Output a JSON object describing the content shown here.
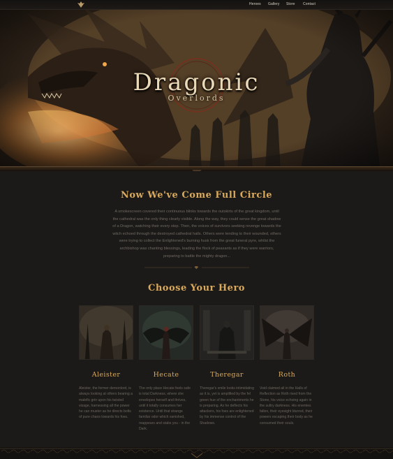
{
  "nav": {
    "items": [
      "Heroes",
      "Gallery",
      "Store",
      "Contact"
    ]
  },
  "hero": {
    "title": "Dragonic",
    "subtitle": "Overlords"
  },
  "intro": {
    "title": "Now We've Come Full Circle",
    "text": "A smokescreen covered their continuous blinks towards the outskirts of the great kingdom, until the cathedral was the only thing clearly visible. Along the way, they could sense the great shadow of a Dragon, watching their every step. Then, the voices of survivors seeking revenge towards the witch echoed through the destroyed cathedral halls. Others were tending to their wounded, others were trying to collect the Enlightened's burning husk from the great funeral pyre, whilst the archbishop was chanting blessings, leading the flock of peasants as if they were warriors, preparing to battle the mighty dragon..."
  },
  "heroes_section": {
    "title": "Choose Your Hero",
    "heroes": [
      {
        "name": "Aleister",
        "bio": "Aleister, the former demonlord, is always looking at others bearing a malefic grin upon his twisted visage, harnessing all the power he can muster as he directs bolts of pure chaos towards his foes."
      },
      {
        "name": "Hecate",
        "bio": "The only place Hecate feels safe is total Darkness, where she envelopes herself and thrives, until it totally consumes her existence. Until that strange familiar odor which vanished, reappears and stabs you - in the Dark."
      },
      {
        "name": "Theregar",
        "bio": "Theregar's smile looks intimidating as it is, yet is amplified by the fel green hue of the enchantments he is preparing. As he deflects his attackers, his foes are enlightened by his immense control of the Shadows."
      },
      {
        "name": "Roth",
        "bio": "Void claimed all in the Halls of Reflection as Roth rised from the Stone, his voice echoing again in the sultry darkness. His enemies fallen, their eyesight blurred, their powers escaping their body as he consumed their souls."
      }
    ]
  },
  "colors": {
    "accent": "#d9a95c",
    "background": "#1c1a18",
    "body_text": "#6f6a63"
  },
  "icons": [
    "winged-logo-icon",
    "ornament-divider-icon"
  ]
}
